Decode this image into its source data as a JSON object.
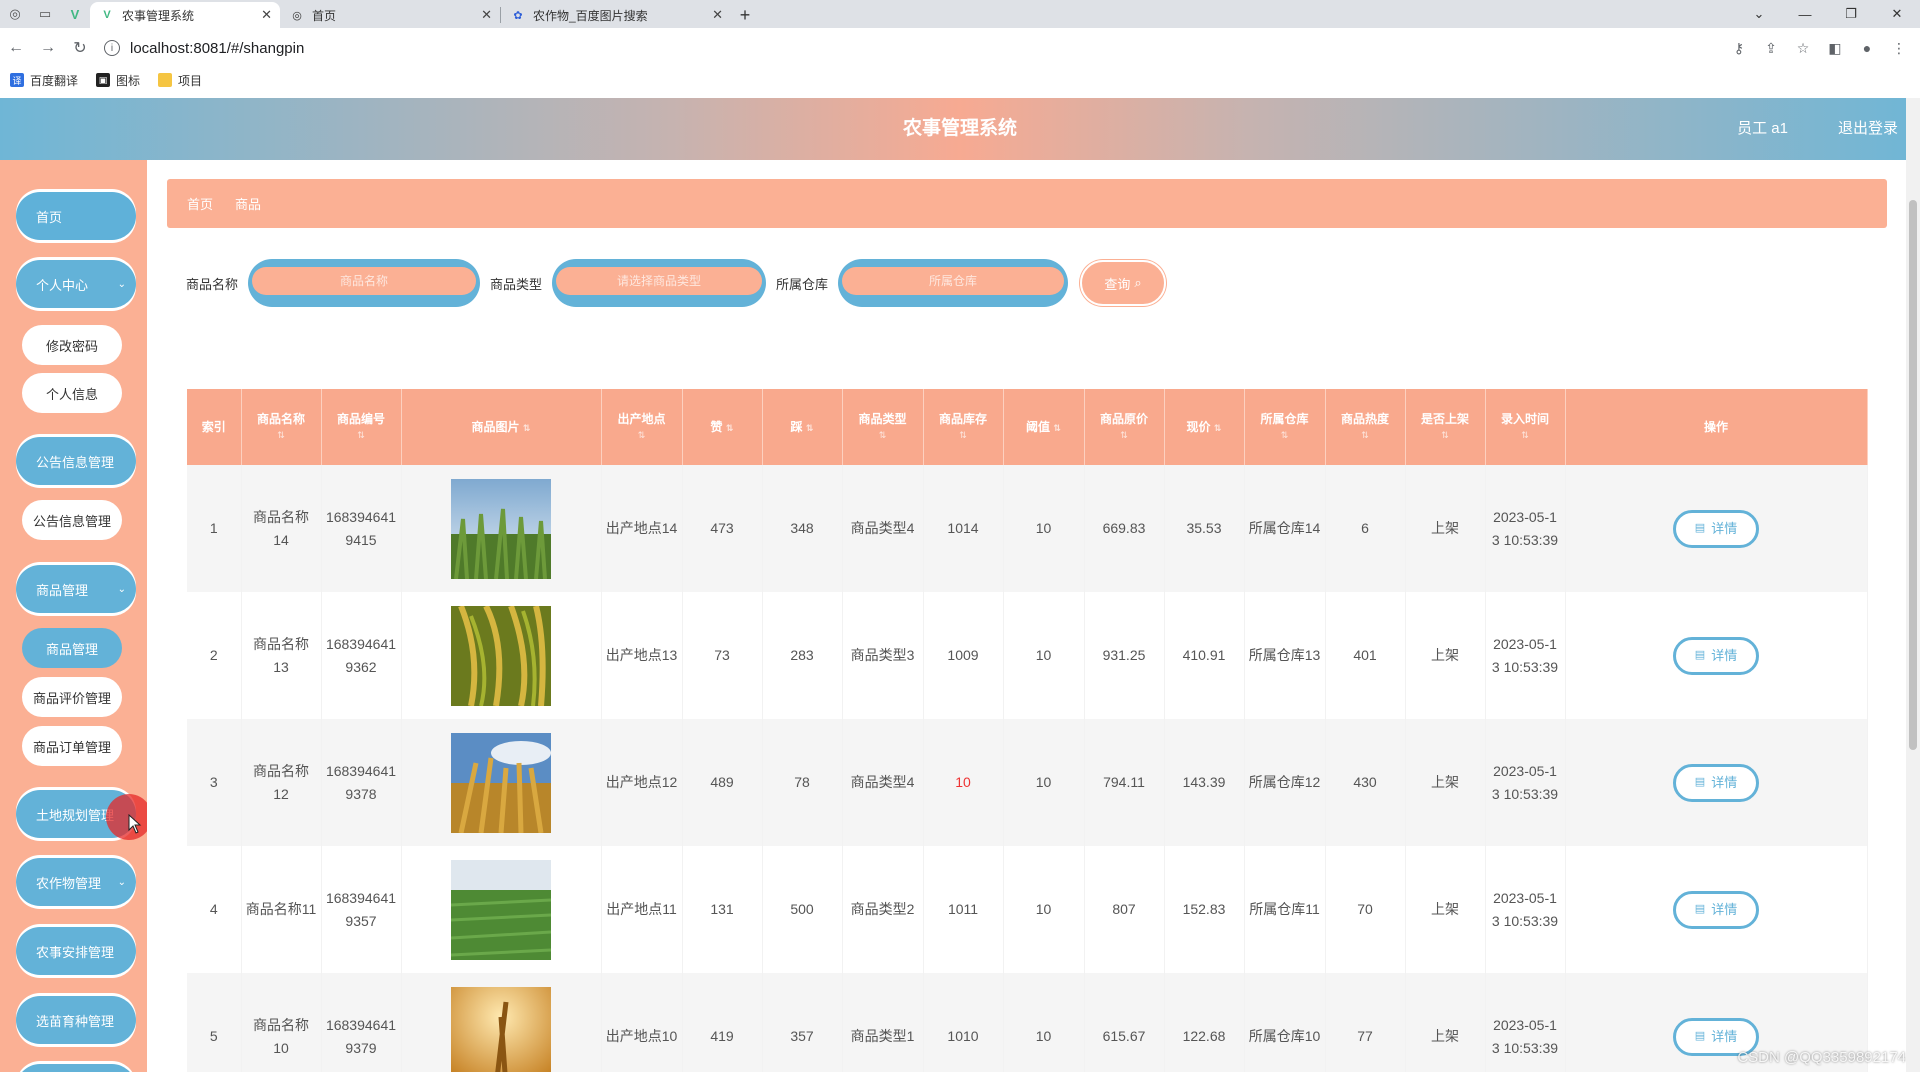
{
  "browser": {
    "tabs": [
      {
        "title": "农事管理系统",
        "active": true
      },
      {
        "title": "首页",
        "active": false
      },
      {
        "title": "农作物_百度图片搜索",
        "active": false
      }
    ],
    "url": "localhost:8081/#/shangpin",
    "bookmarks": [
      "百度翻译",
      "图标",
      "项目"
    ]
  },
  "header": {
    "title": "农事管理系统",
    "user": "员工 a1",
    "logout": "退出登录"
  },
  "sidebar": {
    "items": [
      {
        "label": "首页",
        "type": "main"
      },
      {
        "label": "个人中心",
        "type": "main",
        "expandable": true
      },
      {
        "label": "修改密码",
        "type": "sub"
      },
      {
        "label": "个人信息",
        "type": "sub"
      },
      {
        "label": "公告信息管理",
        "type": "main",
        "expandable": true
      },
      {
        "label": "公告信息管理",
        "type": "sub"
      },
      {
        "label": "商品管理",
        "type": "main",
        "expandable": true
      },
      {
        "label": "商品管理",
        "type": "sub",
        "active": true
      },
      {
        "label": "商品评价管理",
        "type": "sub"
      },
      {
        "label": "商品订单管理",
        "type": "sub"
      },
      {
        "label": "土地规划管理",
        "type": "main",
        "expandable": true
      },
      {
        "label": "农作物管理",
        "type": "main",
        "expandable": true
      },
      {
        "label": "农事安排管理",
        "type": "main",
        "expandable": true
      },
      {
        "label": "选苗育种管理",
        "type": "main",
        "expandable": true
      }
    ]
  },
  "breadcrumb": [
    "首页",
    "商品"
  ],
  "search": {
    "name_label": "商品名称",
    "name_placeholder": "商品名称",
    "type_label": "商品类型",
    "type_placeholder": "请选择商品类型",
    "warehouse_label": "所属仓库",
    "warehouse_placeholder": "所属仓库",
    "query_label": "查询"
  },
  "table": {
    "columns": [
      "索引",
      "商品名称",
      "商品编号",
      "商品图片",
      "出产地点",
      "赞",
      "踩",
      "商品类型",
      "商品库存",
      "阈值",
      "商品原价",
      "现价",
      "所属仓库",
      "商品热度",
      "是否上架",
      "录入时间",
      "操作"
    ],
    "detail_label": "详情",
    "rows": [
      {
        "index": "1",
        "name": "商品名称14",
        "code": "1683946419415",
        "origin": "出产地点14",
        "likes": "473",
        "dislikes": "348",
        "type": "商品类型4",
        "stock": "1014",
        "threshold": "10",
        "orig_price": "669.83",
        "price": "35.53",
        "warehouse": "所属仓库14",
        "heat": "6",
        "onsale": "上架",
        "time": "2023-05-13 10:53:39",
        "low_stock": false,
        "image": "corn-field"
      },
      {
        "index": "2",
        "name": "商品名称13",
        "code": "1683946419362",
        "origin": "出产地点13",
        "likes": "73",
        "dislikes": "283",
        "type": "商品类型3",
        "stock": "1009",
        "threshold": "10",
        "orig_price": "931.25",
        "price": "410.91",
        "warehouse": "所属仓库13",
        "heat": "401",
        "onsale": "上架",
        "time": "2023-05-13 10:53:39",
        "low_stock": false,
        "image": "rice-ear"
      },
      {
        "index": "3",
        "name": "商品名称12",
        "code": "1683946419378",
        "origin": "出产地点12",
        "likes": "489",
        "dislikes": "78",
        "type": "商品类型4",
        "stock": "10",
        "threshold": "10",
        "orig_price": "794.11",
        "price": "143.39",
        "warehouse": "所属仓库12",
        "heat": "430",
        "onsale": "上架",
        "time": "2023-05-13 10:53:39",
        "low_stock": true,
        "image": "wheat-sky"
      },
      {
        "index": "4",
        "name": "商品名称11",
        "code": "1683946419357",
        "origin": "出产地点11",
        "likes": "131",
        "dislikes": "500",
        "type": "商品类型2",
        "stock": "1011",
        "threshold": "10",
        "orig_price": "807",
        "price": "152.83",
        "warehouse": "所属仓库11",
        "heat": "70",
        "onsale": "上架",
        "time": "2023-05-13 10:53:39",
        "low_stock": false,
        "image": "green-field"
      },
      {
        "index": "5",
        "name": "商品名称10",
        "code": "1683946419379",
        "origin": "出产地点10",
        "likes": "419",
        "dislikes": "357",
        "type": "商品类型1",
        "stock": "1010",
        "threshold": "10",
        "orig_price": "615.67",
        "price": "122.68",
        "warehouse": "所属仓库10",
        "heat": "77",
        "onsale": "上架",
        "time": "2023-05-13 10:53:39",
        "low_stock": false,
        "image": "golden-wheat"
      }
    ]
  },
  "watermark": "CSDN @QQ3359892174",
  "colors": {
    "accent_blue": "#63b2d8",
    "accent_salmon": "#fbb094",
    "low_stock": "#e33333"
  }
}
